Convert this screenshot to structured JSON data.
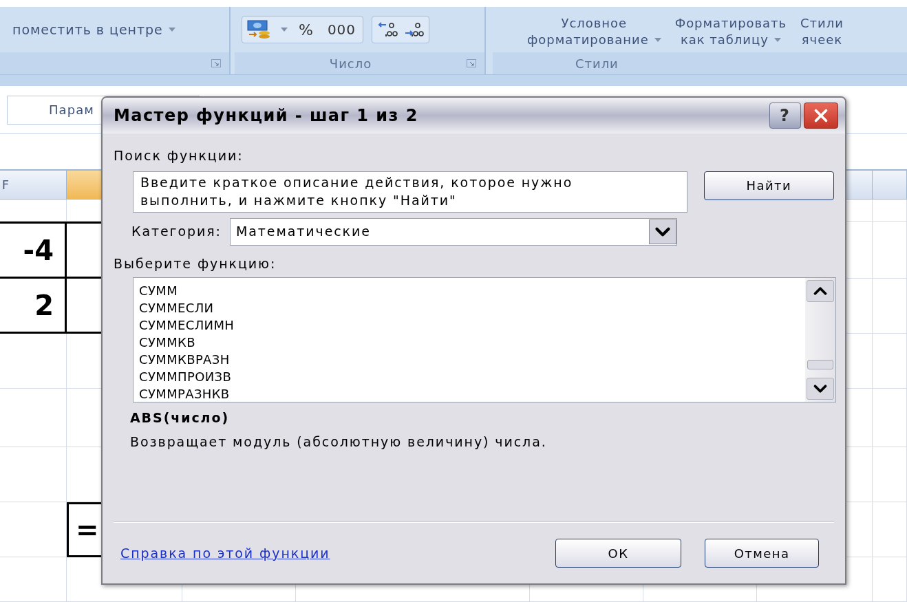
{
  "ribbon": {
    "merge_label": "поместить в центре",
    "number_group": {
      "label": "Число",
      "percent": "%",
      "thousands": "000"
    },
    "styles_group": {
      "label": "Стили",
      "buttons": [
        {
          "lines": [
            "Условное",
            "форматирование"
          ],
          "dropdown": true
        },
        {
          "lines": [
            "Форматировать",
            "как таблицу"
          ],
          "dropdown": true
        },
        {
          "lines": [
            "Стили",
            "ячеек"
          ],
          "dropdown": false
        }
      ]
    }
  },
  "name_box": "Парам",
  "sheet": {
    "columns": [
      {
        "label": "F",
        "selected": false
      },
      {
        "selected": true
      }
    ],
    "column_f_values": [
      "-4",
      "2"
    ],
    "formula_cell": "="
  },
  "dialog": {
    "title": "Мастер функций - шаг 1 из 2",
    "help_button": "?",
    "search_label": "Поиск функции:",
    "search_value": "Введите краткое описание действия, которое нужно выполнить, и нажмите кнопку \"Найти\"",
    "find_button": "Найти",
    "category_label": "Категория:",
    "category_value": "Математические",
    "list_label": "Выберите функцию:",
    "functions": [
      "СУММ",
      "СУММЕСЛИ",
      "СУММЕСЛИМН",
      "СУММКВ",
      "СУММКВРАЗН",
      "СУММПРОИЗВ",
      "СУММРАЗНКВ"
    ],
    "signature": "ABS(число)",
    "description": "Возвращает модуль (абсолютную величину) числа.",
    "help_link": "Справка по этой функции",
    "ok_button": "ОК",
    "cancel_button": "Отмена"
  }
}
